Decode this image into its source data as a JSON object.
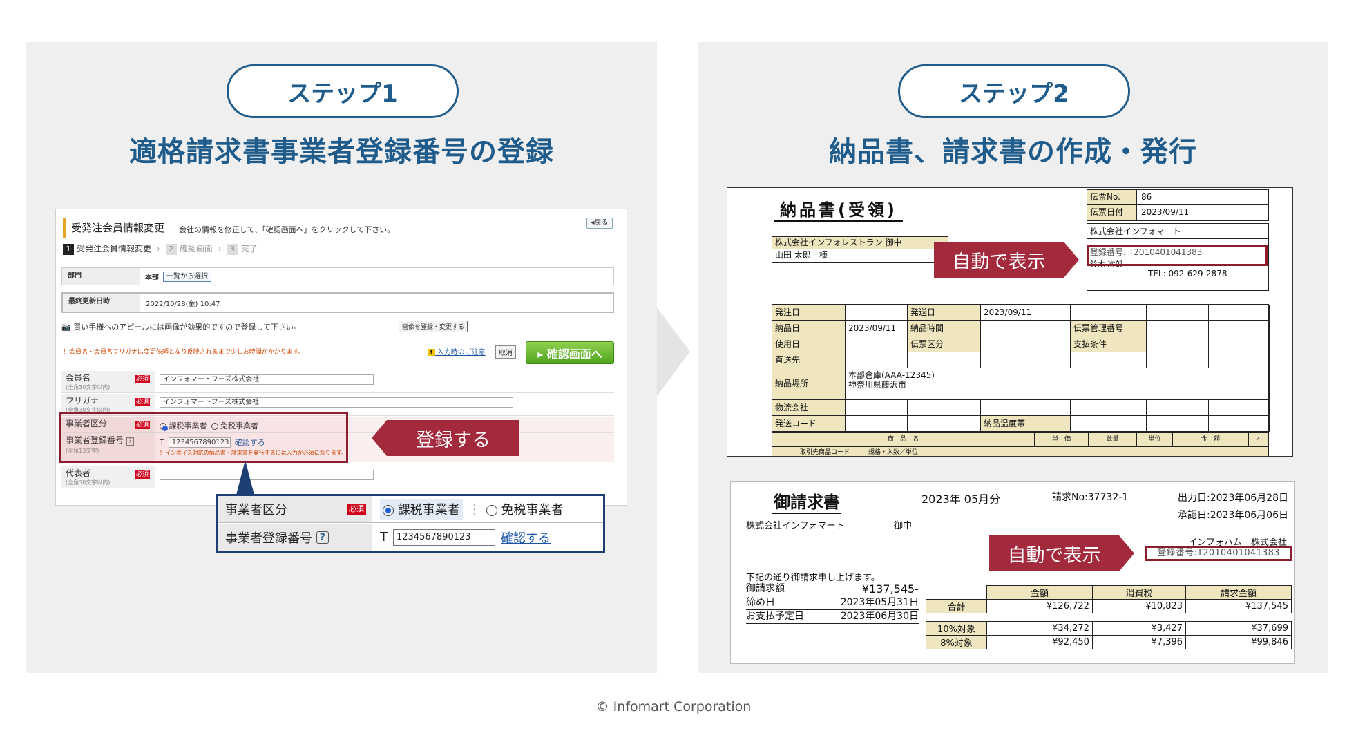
{
  "step1": {
    "pill": "ステップ1",
    "title": "適格請求書事業者登録番号の登録",
    "form": {
      "header": "受発注会員情報変更",
      "note": "会社の情報を修正して、「確認画面へ」をクリックして下さい。",
      "back": "◂戻る",
      "steps": [
        {
          "num": "1",
          "label": "受発注会員情報変更"
        },
        {
          "num": "2",
          "label": "確認画面"
        },
        {
          "num": "3",
          "label": "完了"
        }
      ],
      "dept_label": "部門",
      "dept_value": "本部",
      "dept_button": "一覧から選択",
      "updated_label": "最終更新日時",
      "updated_value": "2022/10/28(金) 10:47",
      "appeal_text": "買い手様へのアピールには画像が効果的ですので登録して下さい。",
      "appeal_button": "画像を登録・変更する",
      "warning": "！会員名・会員名フリガナは変更依頼となり反映されるまで少しお時間がかかります。",
      "caution_link": "入力時のご注意",
      "cancel": "取消",
      "confirm": "▸ 確認画面へ",
      "required": "必須",
      "member_label": "会員名",
      "member_hint": "(全角30文字以内)",
      "member_value": "インフォマートフーズ株式会社",
      "kana_label": "フリガナ",
      "kana_hint": "(全角30文字以内)",
      "kana_value": "インフォマートフーズ株式会社",
      "biz_label": "事業者区分",
      "taxable": "課税事業者",
      "exempt": "免税事業者",
      "reg_label": "事業者登録番号",
      "reg_hint": "(半角13文字)",
      "reg_prefix": "T",
      "reg_value": "1234567890123",
      "reg_link": "確認する",
      "reg_note": "！インボイス対応の納品書・請求書を発行するには入力が必須になります。",
      "rep_label": "代表者",
      "rep_hint": "(全角30文字以内)"
    },
    "callout": "登録する",
    "zoom": {
      "biz_label": "事業者区分",
      "required": "必須",
      "taxable": "課税事業者",
      "exempt": "免税事業者",
      "reg_label": "事業者登録番号",
      "reg_help": "?",
      "reg_prefix": "T",
      "reg_value": "1234567890123",
      "reg_link": "確認する"
    }
  },
  "step2": {
    "pill": "ステップ2",
    "title": "納品書、請求書の作成・発行",
    "callout1": "自動で表示",
    "callout2": "自動で表示",
    "delivery": {
      "title": "納品書(受領)",
      "slip_no_label": "伝票No.",
      "slip_no": "86",
      "slip_date_label": "伝票日付",
      "slip_date": "2023/09/11",
      "customer": "株式会社インフォレストラン 御中",
      "customer_person": "山田 太郎　様",
      "supplier": "株式会社インフォマート",
      "reg_no": "登録番号: T2010401041383",
      "supplier_person": "鈴木 次郎",
      "tel": "TEL:  092-629-2878",
      "grid": [
        "発注日",
        "",
        "発送日",
        "2023/09/11",
        "",
        "",
        "",
        "納品日",
        "2023/09/11",
        "納品時間",
        "",
        "伝票管理番号",
        "",
        "",
        "使用日",
        "",
        "伝票区分",
        "",
        "支払条件",
        "",
        "",
        "直送先",
        "",
        "",
        "",
        "",
        "",
        "",
        "納品場所",
        "本部倉庫(AAA-12345)",
        "",
        "",
        "",
        "",
        "",
        "物流会社",
        "",
        "",
        "",
        "",
        "",
        "",
        "発送コード",
        "",
        "",
        "納品温度帯",
        "",
        "",
        ""
      ],
      "address": "神奈川県藤沢市",
      "items_headers": [
        "商　品　名",
        "単　価",
        "数量",
        "単位",
        "金　額",
        "✓"
      ],
      "items_sub": "取引先商品コード　　　規格・入数／単位"
    },
    "invoice": {
      "title": "御請求書",
      "period": "2023年 05月分",
      "no": "請求No:37732-1",
      "output_date": "出力日:2023年06月28日",
      "approved_date": "承認日:2023年06月06日",
      "to": "株式会社インフォマート",
      "honor": "御中",
      "from": "インフォハム　株式会社",
      "reg_no": "登録番号:T2010401041383",
      "message": "下記の通り御請求申し上げます。",
      "summary": [
        {
          "k": "御請求額",
          "v": "¥137,545-"
        },
        {
          "k": "締め日",
          "v": "2023年05月31日"
        },
        {
          "k": "お支払予定日",
          "v": "2023年06月30日"
        }
      ],
      "headers": [
        "金額",
        "消費税",
        "請求金額"
      ],
      "total_label": "合計",
      "total": [
        "¥126,722",
        "¥10,823",
        "¥137,545"
      ],
      "rows": [
        {
          "k": "10%対象",
          "v": [
            "¥34,272",
            "¥3,427",
            "¥37,699"
          ]
        },
        {
          "k": "8%対象",
          "v": [
            "¥92,450",
            "¥7,396",
            "¥99,846"
          ]
        }
      ]
    }
  },
  "footer": "© Infomart Corporation"
}
